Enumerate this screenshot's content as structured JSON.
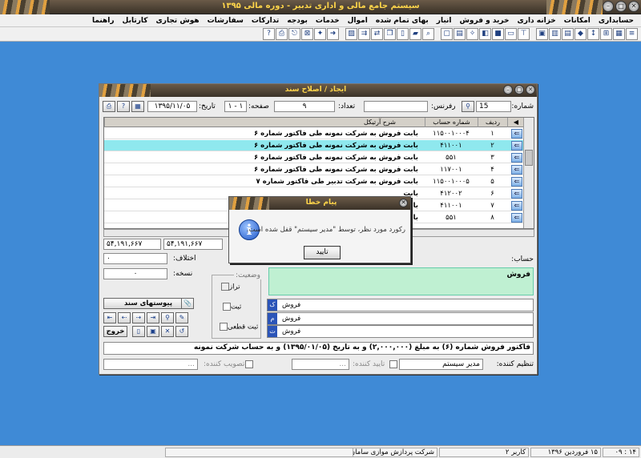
{
  "app": {
    "title": "سیستم جامع مالی و اداری تدبیر - دوره مالی ۱۳۹۵"
  },
  "menu": [
    "حسابداری",
    "امکانات",
    "خزانه داری",
    "خرید و فروش",
    "انبار",
    "بهای تمام شده",
    "اموال",
    "خدمات",
    "بودجه",
    "تدارکات",
    "سفارشات",
    "هوش تجاری",
    "کارتابل",
    "راهنما"
  ],
  "toolbar_icons": [
    "list-icon",
    "grid-icon",
    "tree-icon",
    "arrows-icon",
    "cube-icon",
    "calendar-icon",
    "table-icon",
    "stack-icon",
    "stamp-icon",
    "cards-icon",
    "color-icon",
    "cube2-icon",
    "tools-icon",
    "sheet-icon",
    "card-icon",
    "search-icon",
    "folder-icon",
    "doc-icon",
    "copy-icon",
    "switch-icon",
    "flow-icon",
    "image-icon",
    "arrow-icon",
    "star-icon",
    "cart-icon",
    "exit-icon",
    "print-icon",
    "help-icon"
  ],
  "form": {
    "title": "ایجاد / اصلاح سند",
    "number_label": "شماره:",
    "number_value": "15",
    "reference_label": "رفرنس:",
    "reference_value": "",
    "date_label": "تاریخ:",
    "date_value": "۱۳۹۵/۱۱/۰۵",
    "page_label": "صفحه:",
    "page_value": "۱ - ۱",
    "count_label": "تعداد:",
    "count_value": "۹",
    "grid_headers": [
      "ردیف",
      "شماره حساب",
      "شرح آرتیکل"
    ],
    "rows": [
      {
        "idx": "۱",
        "account": "۱۱۵۰۰۱۰۰۰۴",
        "desc": "بابت فروش به شرکت نمونه طی فاکتور شماره ۶"
      },
      {
        "idx": "۲",
        "account": "۴۱۱۰۰۱",
        "desc": "بابت فروش به شرکت نمونه طی فاکتور شماره ۶"
      },
      {
        "idx": "۳",
        "account": "۵۵۱",
        "desc": "بابت فروش به شرکت نمونه طی فاکتور شماره ۶"
      },
      {
        "idx": "۴",
        "account": "۱۱۷۰۰۱",
        "desc": "بابت فروش به شرکت نمونه طی فاکتور شماره ۶"
      },
      {
        "idx": "۵",
        "account": "۱۱۵۰۰۱۰۰۰۵",
        "desc": "بابت فروش به شرکت تدبیر طی فاکتور شماره ۷"
      },
      {
        "idx": "۶",
        "account": "۴۱۲۰۰۲",
        "desc": "بابت"
      },
      {
        "idx": "۷",
        "account": "۴۱۱۰۰۱",
        "desc": "بابت"
      },
      {
        "idx": "۸",
        "account": "۵۵۱",
        "desc": "بابت"
      }
    ],
    "total_debit": "۵۴,۱۹۱,۶۶۷",
    "total_credit": "۵۴,۱۹۱,۶۶۷",
    "difference_label": "اختلاف:",
    "difference_value": "۰",
    "copies_label": "نسخه:",
    "copies_value": "۰",
    "account_label": "حساب:",
    "status_legend": "وضعیت:",
    "status_items": [
      "تراز",
      "ثبت",
      "ثبت قطعی"
    ],
    "attachments_label": "پیوستهای سند",
    "exit_label": "خروج",
    "account_header": "فروش",
    "account_rows": [
      "فروش",
      "فروش",
      "فروش"
    ],
    "description": "فاکتور فروش شماره (۶) به مبلغ (۲,۰۰۰,۰۰۰) و به تاریخ (۱۳۹۵/۰۱/۰۵) و به حساب شرکت نمونه",
    "prepared_by_label": "تنظیم کننده:",
    "prepared_by_value": "مدیر سیستم",
    "approved_by_label": "تایید کننده:",
    "approved_by_value": "...",
    "confirmed_by_label": "تصویب کننده:",
    "confirmed_by_value": "..."
  },
  "dialog": {
    "title": "پیام خطا",
    "message": "رکورد مورد نظر، توسط \"مدیر سیستم\" قفل شده است.",
    "ok_label": "تایید"
  },
  "statusbar": {
    "time": "۱۴ : ۰۹",
    "date": "۱۵ فروردین ۱۳۹۶",
    "user": "کاربر ۲",
    "company": "شرکت پردازش موازی سامان"
  }
}
